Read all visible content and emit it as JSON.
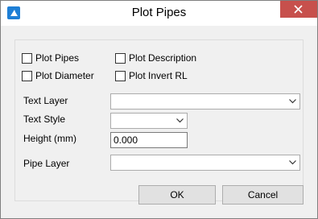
{
  "window": {
    "title": "Plot Pipes",
    "app_icon": "bricscad-logo-icon",
    "close_icon": "close-icon"
  },
  "options": {
    "plot_pipes": {
      "label": "Plot Pipes",
      "checked": false
    },
    "plot_description": {
      "label": "Plot Description",
      "checked": false
    },
    "plot_diameter": {
      "label": "Plot Diameter",
      "checked": false
    },
    "plot_invert_rl": {
      "label": "Plot Invert RL",
      "checked": false
    }
  },
  "fields": {
    "text_layer": {
      "label": "Text Layer",
      "value": ""
    },
    "text_style": {
      "label": "Text Style",
      "value": ""
    },
    "height": {
      "label": "Height (mm)",
      "value": "0.000"
    },
    "pipe_layer": {
      "label": "Pipe Layer",
      "value": ""
    }
  },
  "buttons": {
    "ok": "OK",
    "cancel": "Cancel"
  },
  "colors": {
    "close_button": "#c7504c",
    "icon_blue": "#1e7fd6",
    "dialog_bg": "#f0f0f0"
  }
}
